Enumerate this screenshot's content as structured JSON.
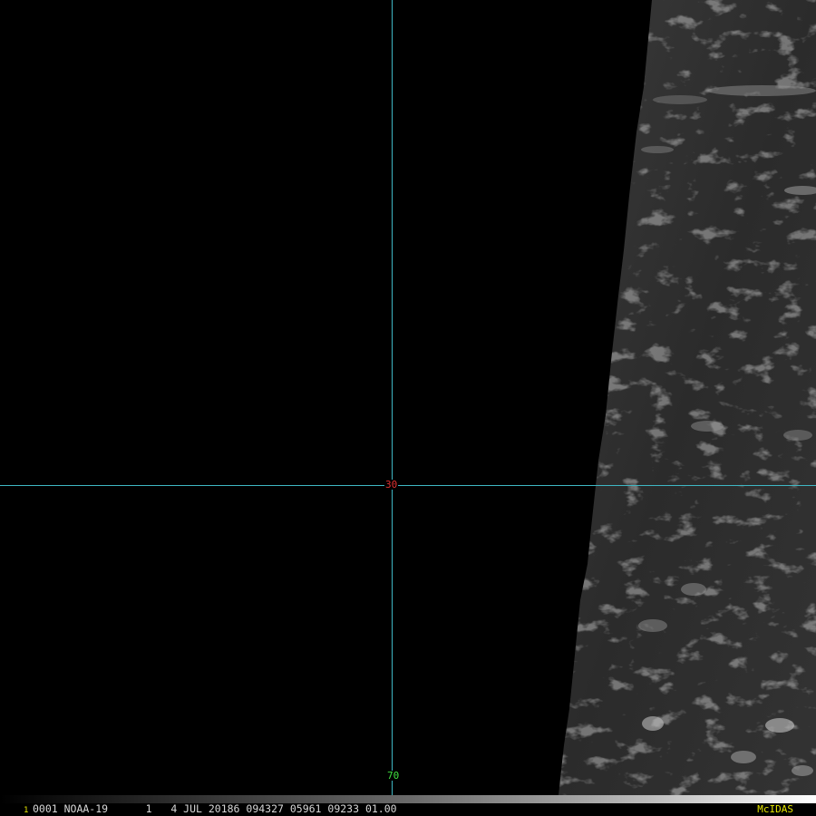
{
  "image": {
    "frame_number": "1",
    "status_line": "0001 NOAA-19      1   4 JUL 20186 094327 05961 09233 01.00",
    "software": "McIDAS"
  },
  "gridlines": {
    "latitude_label": "30",
    "longitude_label": "70"
  },
  "colors": {
    "gridline": "#3fb7c4",
    "latitude_label": "#e03030",
    "longitude_label": "#40e040",
    "frame_number": "#e6e600",
    "software_label": "#e6e600",
    "status_text": "#d8d8d8"
  }
}
